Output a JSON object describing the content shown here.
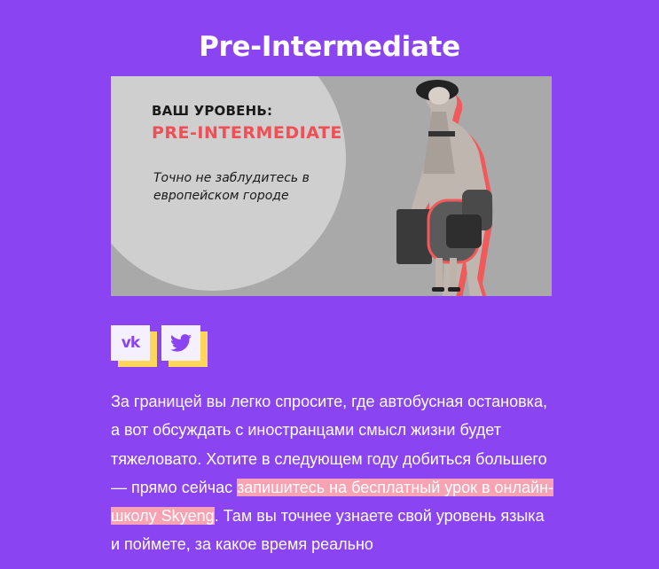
{
  "page": {
    "title": "Pre-Intermediate"
  },
  "banner": {
    "heading": "ВАШ УРОВЕНЬ:",
    "level": "PRE-INTERMEDIATE",
    "tagline": "Точно не заблудитесь в европейском городе",
    "colors": {
      "background": "#a9a9a9",
      "circle": "#cfcfcf",
      "level_text": "#ef4f55"
    }
  },
  "social": {
    "vk": {
      "icon": "vk-icon",
      "glyph": "vk"
    },
    "twitter": {
      "icon": "twitter-icon"
    }
  },
  "article": {
    "text_before_link": "За границей вы легко спросите, где автобусная остановка, а вот обсуждать с иностранцами смысл жизни будет тяжеловато. Хотите в следующем году добиться большего — прямо сейчас ",
    "link_text": "запишитесь на бесплатный урок в онлайн-школу Skyeng",
    "text_after_link": ". Там вы точнее узнаете свой уровень языка и поймете, за какое время реально"
  },
  "colors": {
    "page_background": "#8a44f2",
    "icon_tile": "#f4f0ff",
    "icon_shadow": "#ffd65a",
    "link_highlight": "#f7a3b4"
  }
}
